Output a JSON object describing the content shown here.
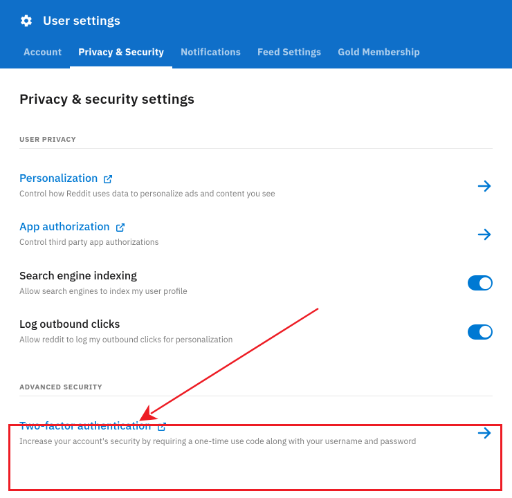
{
  "header": {
    "title": "User settings"
  },
  "tabs": [
    {
      "label": "Account",
      "active": false
    },
    {
      "label": "Privacy & Security",
      "active": true
    },
    {
      "label": "Notifications",
      "active": false
    },
    {
      "label": "Feed Settings",
      "active": false
    },
    {
      "label": "Gold Membership",
      "active": false
    }
  ],
  "page_title": "Privacy & security settings",
  "sections": {
    "user_privacy": {
      "header": "USER PRIVACY",
      "items": [
        {
          "title": "Personalization",
          "desc": "Control how Reddit uses data to personalize ads and content you see",
          "type": "link"
        },
        {
          "title": "App authorization",
          "desc": "Control third party app authorizations",
          "type": "link"
        },
        {
          "title": "Search engine indexing",
          "desc": "Allow search engines to index my user profile",
          "type": "toggle",
          "on": true
        },
        {
          "title": "Log outbound clicks",
          "desc": "Allow reddit to log my outbound clicks for personalization",
          "type": "toggle",
          "on": true
        }
      ]
    },
    "advanced_security": {
      "header": "ADVANCED SECURITY",
      "items": [
        {
          "title": "Two-factor authentication",
          "desc": "Increase your account's security by requiring a one-time use code along with your username and password",
          "type": "link"
        }
      ]
    }
  },
  "colors": {
    "header_bg": "#0f6fc9",
    "link": "#0079d3",
    "annotation": "#ed1c24"
  }
}
